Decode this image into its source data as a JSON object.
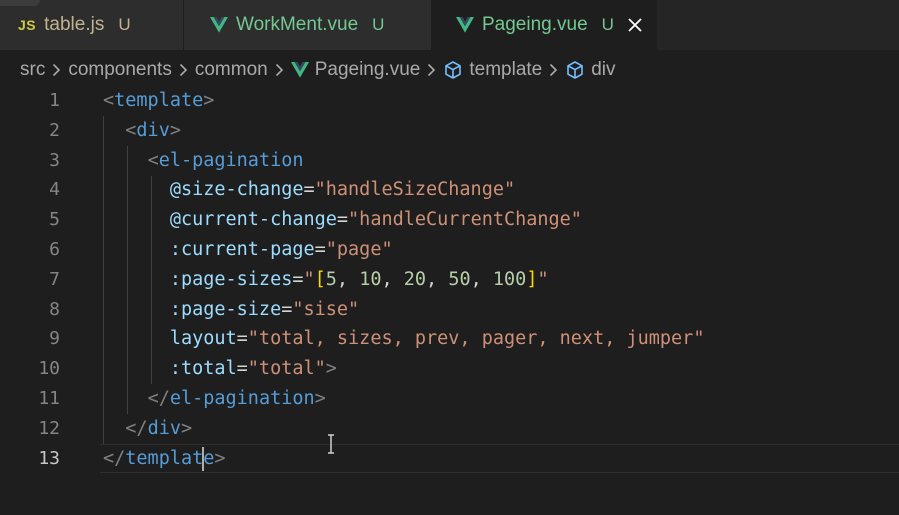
{
  "tabs": [
    {
      "icon": "js-icon",
      "icon_text": "JS",
      "label": "table.js",
      "status": "U",
      "active": false,
      "color": "#c2b38f"
    },
    {
      "icon": "vue-icon",
      "label": "WorkMent.vue",
      "status": "U",
      "active": false,
      "color": "#73c991"
    },
    {
      "icon": "vue-icon",
      "label": "Pageing.vue",
      "status": "U",
      "active": true,
      "color": "#73c991",
      "close_glyph": "✕"
    }
  ],
  "breadcrumb": {
    "items": [
      "src",
      "components",
      "common",
      "Pageing.vue",
      "template",
      "div"
    ],
    "separator": "›"
  },
  "editor": {
    "active_line": 13,
    "lines": [
      {
        "n": "1",
        "text": "<template>"
      },
      {
        "n": "2",
        "text": "  <div>"
      },
      {
        "n": "3",
        "text": "    <el-pagination"
      },
      {
        "n": "4",
        "text": "      @size-change=\"handleSizeChange\""
      },
      {
        "n": "5",
        "text": "      @current-change=\"handleCurrentChange\""
      },
      {
        "n": "6",
        "text": "      :current-page=\"page\""
      },
      {
        "n": "7",
        "text": "      :page-sizes=\"[5, 10, 20, 50, 100]\""
      },
      {
        "n": "8",
        "text": "      :page-size=\"sise\""
      },
      {
        "n": "9",
        "text": "      layout=\"total, sizes, prev, pager, next, jumper\""
      },
      {
        "n": "10",
        "text": "      :total=\"total\">"
      },
      {
        "n": "11",
        "text": "    </el-pagination>"
      },
      {
        "n": "12",
        "text": "  </div>"
      },
      {
        "n": "13",
        "text": "</template>"
      }
    ]
  },
  "colors": {
    "background": "#1e1e1e",
    "tab_inactive": "#2d2d2d",
    "tag": "#569cd6",
    "attribute": "#9cdcfe",
    "string": "#ce9178",
    "bracket": "#ffd700",
    "number": "#b5cea8",
    "vue_green": "#41b883"
  }
}
